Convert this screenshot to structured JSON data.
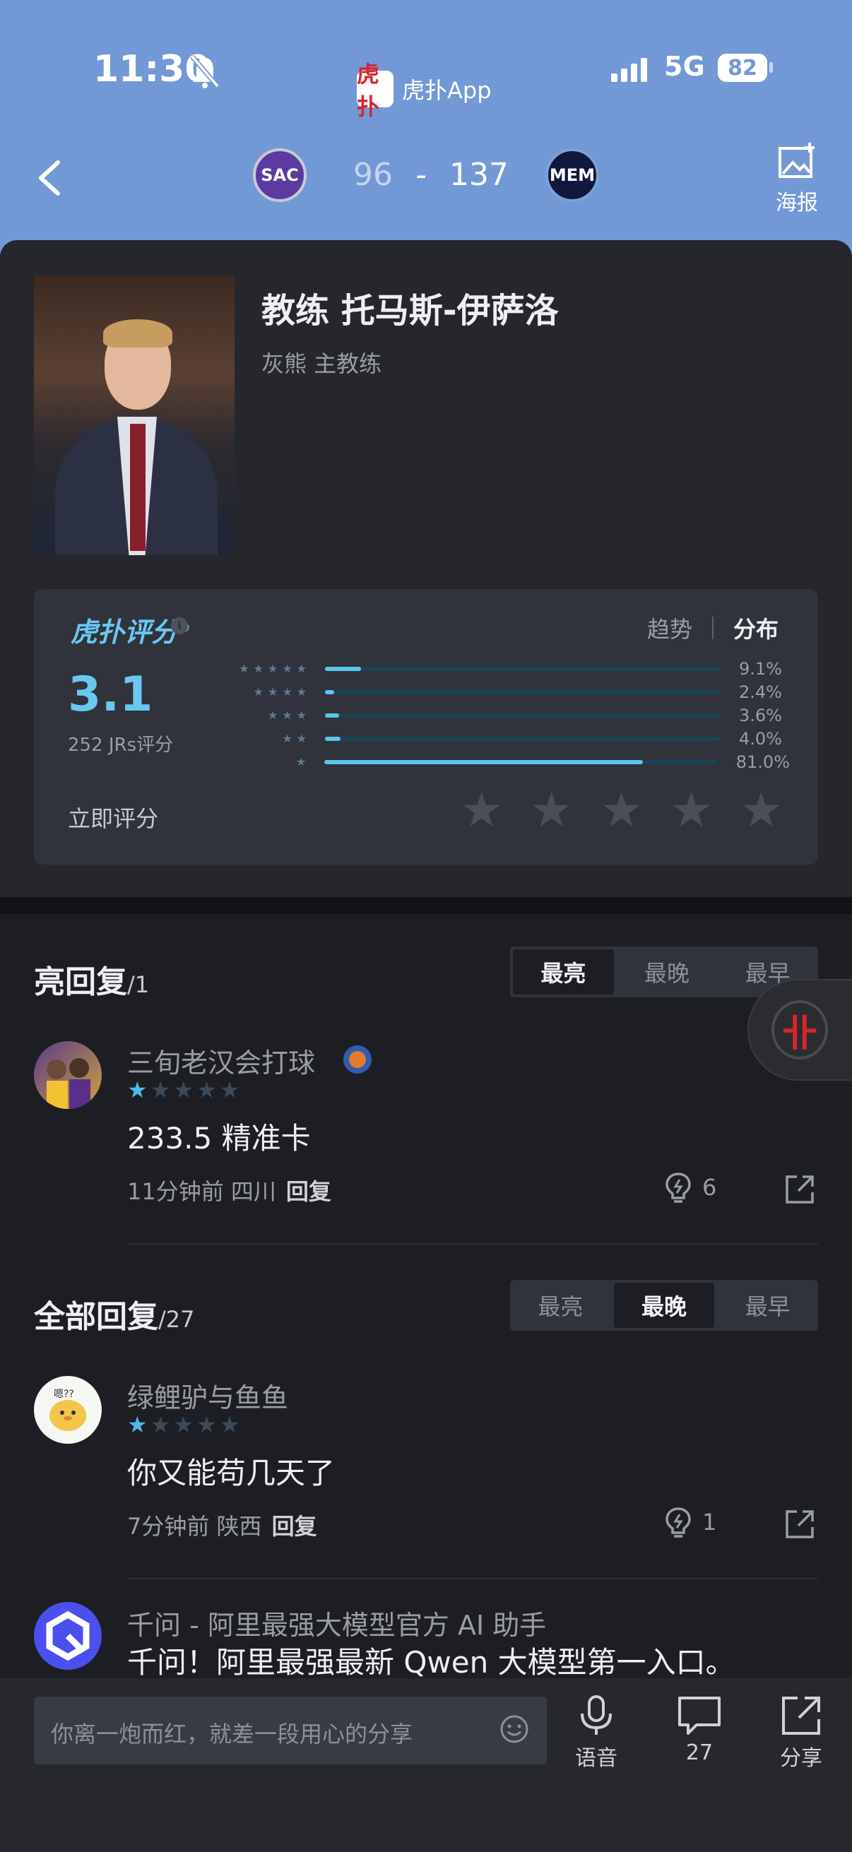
{
  "status_bar": {
    "time": "11:30",
    "app_name": "虎扑App",
    "app_logo_text": "虎扑",
    "network": "5G",
    "battery": "82"
  },
  "header": {
    "home_team": "SAC",
    "away_team": "MEM",
    "home_score": "96",
    "separator": "-",
    "away_score": "137",
    "poster_label": "海报"
  },
  "profile": {
    "title": "教练 托马斯-伊萨洛",
    "subtitle": "灰熊 主教练"
  },
  "rating": {
    "brand": "虎扑评分",
    "registered": "®",
    "info": "i",
    "tab_trend": "趋势",
    "tab_distribution": "分布",
    "score": "3.1",
    "votes": "252 JRs评分",
    "rate_now": "立即评分",
    "distribution": [
      {
        "stars": 5,
        "percent": 9.1,
        "label": "9.1%"
      },
      {
        "stars": 4,
        "percent": 2.4,
        "label": "2.4%"
      },
      {
        "stars": 3,
        "percent": 3.6,
        "label": "3.6%"
      },
      {
        "stars": 2,
        "percent": 4.0,
        "label": "4.0%"
      },
      {
        "stars": 1,
        "percent": 81.0,
        "label": "81.0%"
      }
    ]
  },
  "highlight": {
    "title": "亮回复",
    "count": "/1",
    "tabs": [
      "最亮",
      "最晚",
      "最早"
    ],
    "active_tab": "最亮",
    "comments": [
      {
        "user": "三旬老汉会打球",
        "stars": 1,
        "text": "233.5 精准卡",
        "time": "11分钟前",
        "location": "四川",
        "reply": "回复",
        "likes": "6"
      }
    ]
  },
  "all": {
    "title": "全部回复",
    "count": "/27",
    "tabs": [
      "最亮",
      "最晚",
      "最早"
    ],
    "active_tab": "最晚",
    "comments": [
      {
        "user": "绿鲤驴与鱼鱼",
        "stars": 1,
        "text": "你又能苟几天了",
        "time": "7分钟前",
        "location": "陕西",
        "reply": "回复",
        "likes": "1"
      }
    ],
    "ad": {
      "user": "千问 - 阿里最强大模型官方 AI 助手",
      "text": "千问！阿里最强最新 Qwen 大模型第一入口。"
    }
  },
  "bottom_bar": {
    "input_placeholder": "你离一炮而红，就差一段用心的分享",
    "voice": "语音",
    "comments_count": "27",
    "share": "分享"
  },
  "colors": {
    "header_bg": "#7398d6",
    "accent": "#58c6ef",
    "bg": "#1d1e23"
  }
}
